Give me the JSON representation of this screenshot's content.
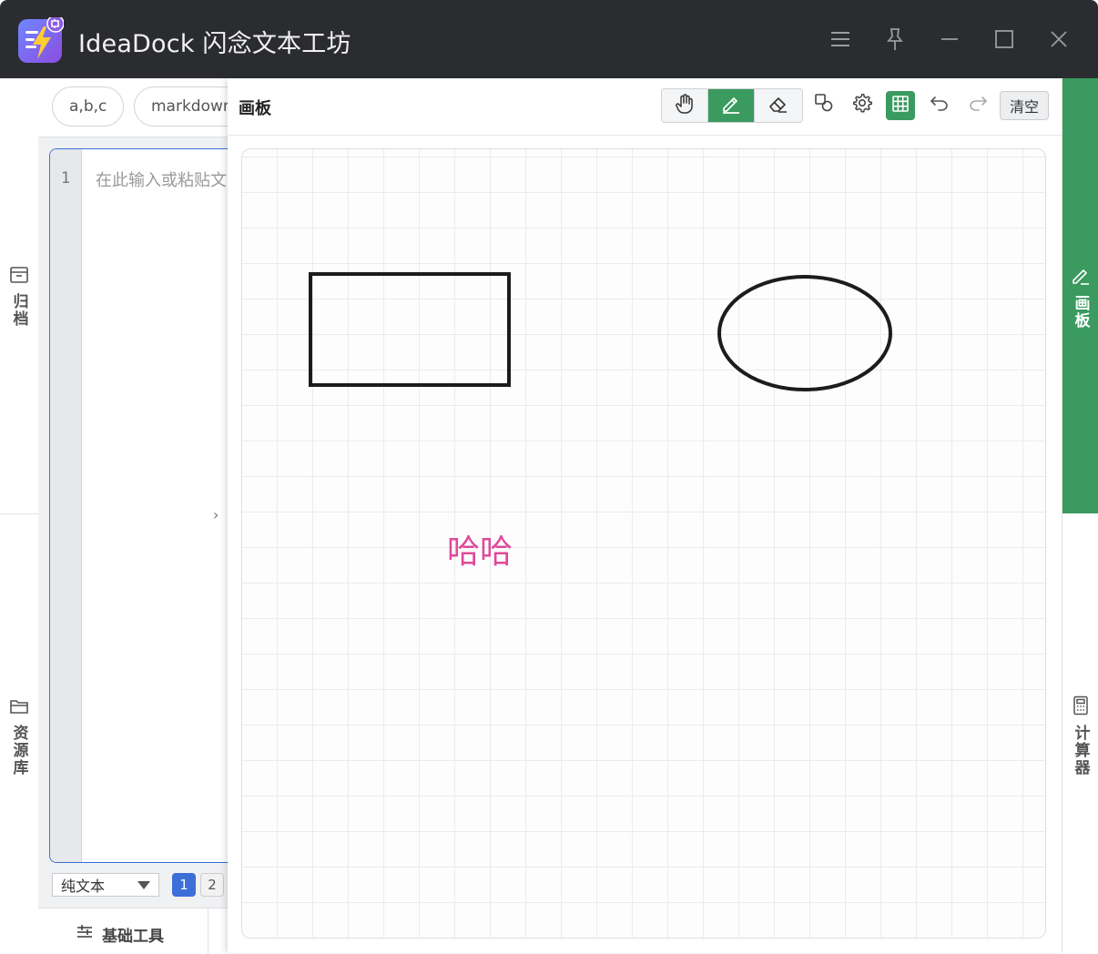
{
  "window": {
    "title": "IdeaDock 闪念文本工坊",
    "logo_icon": "app-logo-lightning-icon",
    "controls": [
      "menu-icon",
      "pin-icon",
      "minimize-icon",
      "maximize-icon",
      "close-icon"
    ]
  },
  "left_rail": {
    "items": [
      {
        "label": "归档",
        "icon": "archive-icon"
      },
      {
        "label": "资源库",
        "icon": "folder-icon"
      }
    ]
  },
  "editor": {
    "chips": [
      "a,b,c",
      "markdown"
    ],
    "line_number": "1",
    "placeholder": "在此输入或粘贴文",
    "collapse_arrow": "›",
    "mode_select": "纯文本",
    "pages": [
      "1",
      "2"
    ],
    "active_page": "1",
    "bottom_tab": {
      "label": "基础工具",
      "icon": "sliders-icon"
    }
  },
  "board": {
    "title": "画板",
    "tools": [
      {
        "name": "hand",
        "icon": "hand-icon",
        "active": false
      },
      {
        "name": "pen",
        "icon": "pen-icon",
        "active": true
      },
      {
        "name": "eraser",
        "icon": "eraser-icon",
        "active": false
      }
    ],
    "actions": [
      "shapes-icon",
      "settings-icon",
      "grid-icon",
      "undo-icon",
      "redo-icon"
    ],
    "grid_enabled": true,
    "clear_label": "清空",
    "canvas": {
      "text": "哈哈",
      "text_color": "#e0499a",
      "shapes": [
        "rectangle",
        "ellipse"
      ],
      "stroke_color": "#1c1c1c"
    }
  },
  "right_rail": {
    "items": [
      {
        "label": "画板",
        "icon": "pen-icon",
        "active": true
      },
      {
        "label": "计算器",
        "icon": "calculator-icon",
        "active": false
      }
    ]
  },
  "colors": {
    "titlebar": "#2b2c2f",
    "accent_green": "#3a9a5f",
    "accent_blue": "#3c6fd8"
  }
}
